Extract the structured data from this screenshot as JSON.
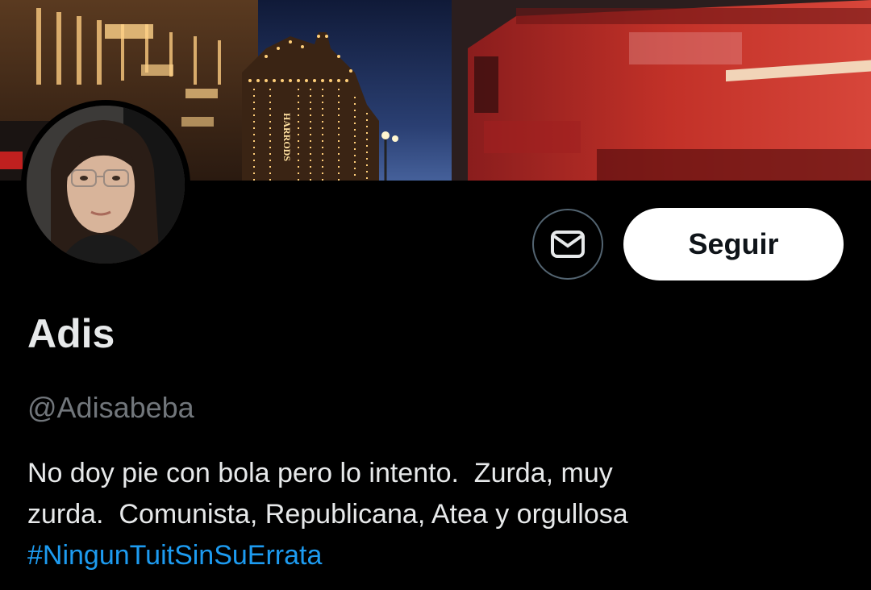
{
  "profile": {
    "name": "Adis",
    "handle": "@Adisabeba",
    "bio_line1": "No doy pie con bola pero lo intento.  Zurda, muy",
    "bio_line2": "zurda.  Comunista, Republicana, Atea y orgullosa",
    "bio_hashtag": "#NingunTuitSinSuErrata"
  },
  "banner": {
    "sign_text": "HARRODS"
  },
  "actions": {
    "message_icon": "envelope-icon",
    "follow_label": "Seguir"
  },
  "colors": {
    "background": "#000000",
    "text_primary": "#e7e9ea",
    "text_secondary": "#71767b",
    "link": "#1d9bf0",
    "button_bg": "#ffffff"
  }
}
